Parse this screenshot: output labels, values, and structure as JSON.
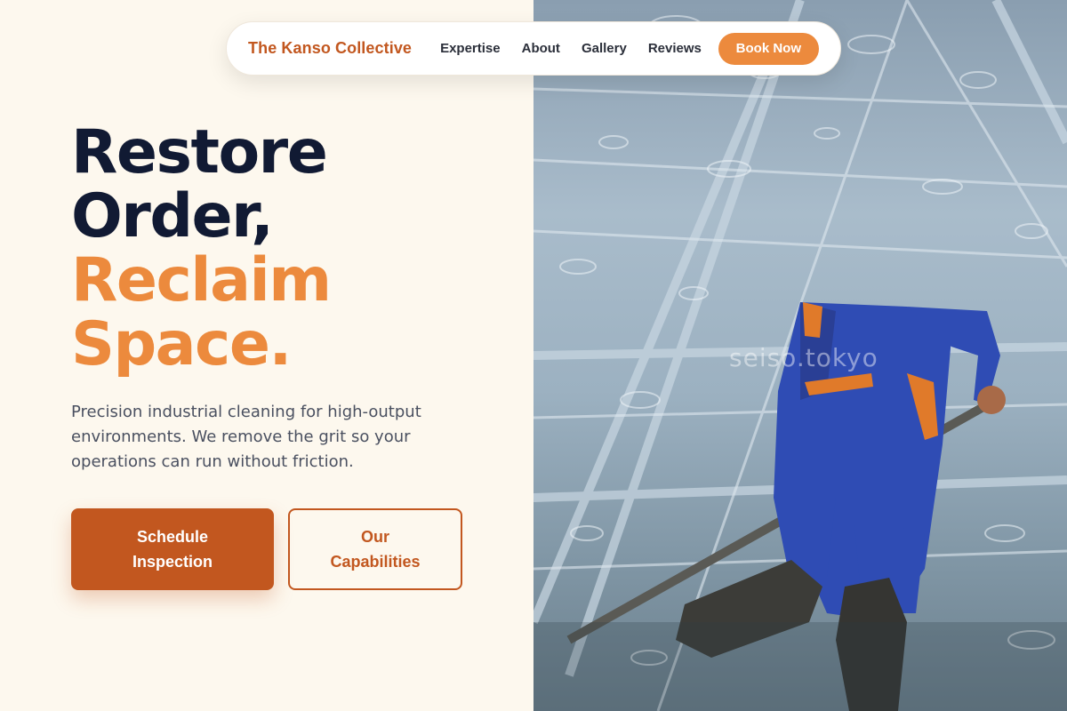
{
  "nav": {
    "brand": "The Kanso Collective",
    "links": [
      "Expertise",
      "About",
      "Gallery",
      "Reviews"
    ],
    "cta": "Book Now"
  },
  "hero": {
    "headline_dark_1": "Restore",
    "headline_dark_2": "Order,",
    "headline_accent_1": "Reclaim",
    "headline_accent_2": "Space.",
    "subtext": "Precision industrial cleaning for high-output environments. We remove the grit so your operations can run without friction.",
    "primary_button": "Schedule Inspection",
    "secondary_button": "Our Capabilities"
  },
  "image": {
    "watermark": "seiso.tokyo",
    "subject": "window cleaner in blue overalls on wet glass"
  },
  "colors": {
    "background": "#fdf8ee",
    "brand": "#c2571f",
    "accent": "#ec8a3d",
    "heading": "#111a33",
    "body_text": "#4a5060"
  }
}
